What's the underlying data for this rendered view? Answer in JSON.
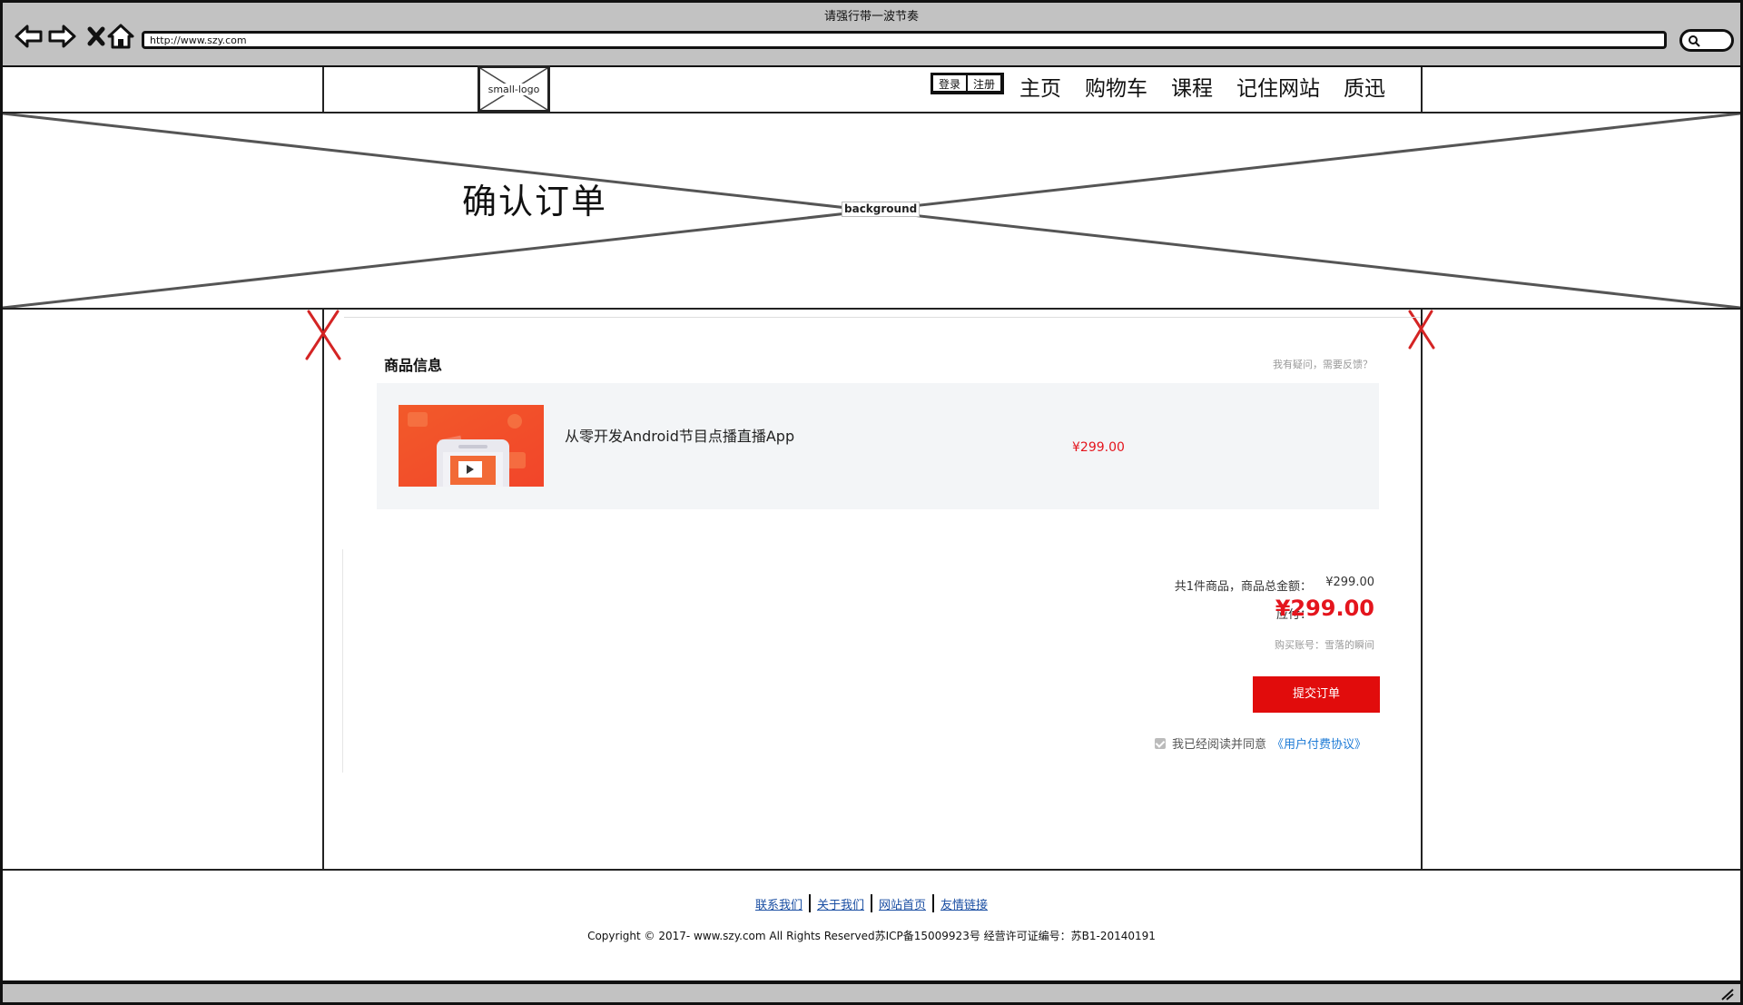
{
  "browser": {
    "title": "请强行带一波节奏",
    "url": "http://www.szy.com"
  },
  "header": {
    "logo_label": "small-logo",
    "auth": {
      "login": "登录",
      "register": "注册"
    },
    "menu": [
      "主页",
      "购物车",
      "课程",
      "记住网站",
      "质迅"
    ]
  },
  "hero": {
    "placeholder_label": "background",
    "title": "确认订单"
  },
  "order": {
    "section_title": "商品信息",
    "feedback_link": "我有疑问，需要反馈？",
    "product": {
      "name": "从零开发Android节目点播直播App",
      "price": "¥299.00"
    },
    "summary": {
      "total_label": "共1件商品，商品总金额：",
      "total_value": "¥299.00",
      "pay_label": "应付：",
      "pay_value": "¥299.00",
      "buyer": "购买账号：雪落的瞬间"
    },
    "submit_label": "提交订单",
    "agree_text": "我已经阅读并同意",
    "agree_link": "《用户付费协议》",
    "agree_checked": true
  },
  "footer": {
    "links": [
      "联系我们",
      "关于我们",
      "网站首页",
      "友情链接"
    ],
    "copyright": "Copyright © 2017- www.szy.com All Rights Reserved苏ICP备15009923号 经营许可证编号：苏B1-20140191"
  },
  "colors": {
    "accent_red": "#e10c0c",
    "price_red": "#e4151d",
    "link_blue": "#1e7bd6",
    "footer_link": "#1b4fa3",
    "chrome_gray": "#c2c2c2"
  }
}
